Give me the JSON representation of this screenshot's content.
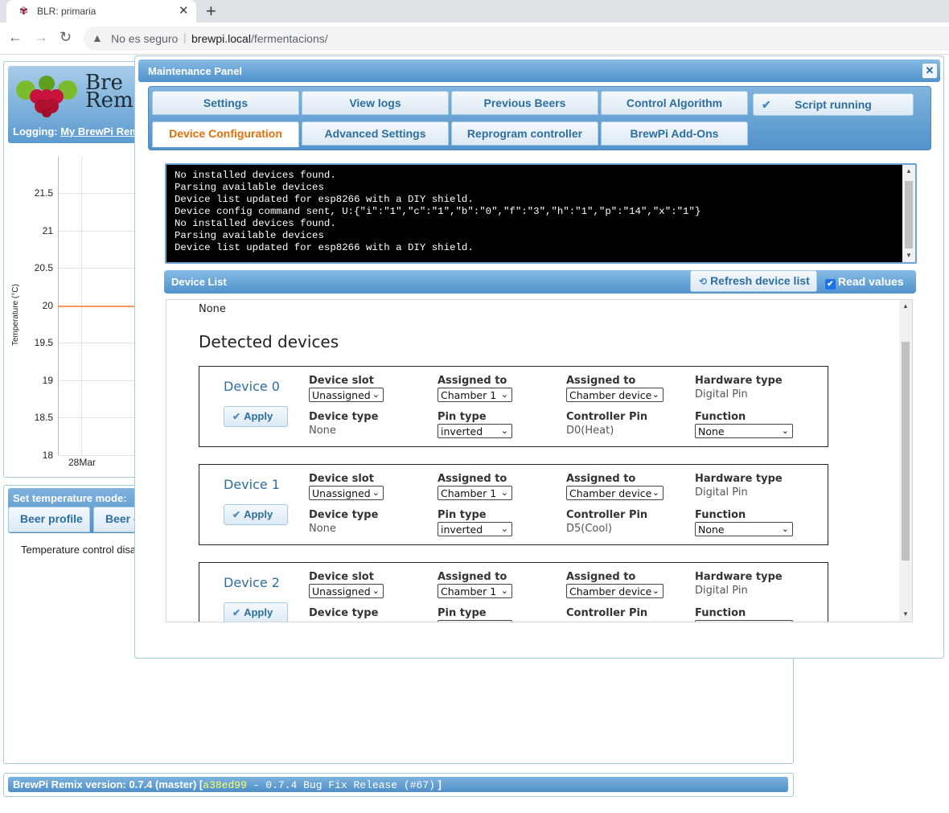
{
  "browser": {
    "tab_title": "BLR: primaria",
    "favicon": "raspberry-favicon",
    "insecure_text": "No es seguro",
    "url_host": "brewpi.local",
    "url_path": "/fermentacions/"
  },
  "background": {
    "logo_text_1": "Bre",
    "logo_text_2": "Rem",
    "logging_label": "Logging:",
    "logging_link": "My BrewPi Rem",
    "chart_ylabel": "Temperature (°C)",
    "y_ticks": [
      "21.5",
      "21",
      "20.5",
      "20",
      "19.5",
      "19",
      "18.5",
      "18"
    ],
    "x_tick": "28Mar",
    "set_temp_label": "Set temperature mode:",
    "mode_buttons": [
      "Beer profile",
      "Beer c"
    ],
    "temp_disabled": "Temperature control disa",
    "footer_version": "BrewPi Remix version: 0.7.4 (master) [",
    "footer_hash": "a38ed99",
    "footer_note": " - 0.7.4 Bug Fix Release (#67)",
    "footer_close": " ]"
  },
  "chart_data": {
    "type": "line",
    "ylabel": "Temperature (°C)",
    "ylim": [
      18,
      21.5
    ],
    "x": [
      "28Mar"
    ],
    "series": [
      {
        "values": [
          20
        ]
      }
    ]
  },
  "dialog": {
    "title": "Maintenance Panel",
    "close_icon": "close-icon",
    "tabs_row1": [
      "Settings",
      "View logs",
      "Previous Beers",
      "Control Algorithm",
      "Script running"
    ],
    "tabs_row2": [
      "Device Configuration",
      "Advanced Settings",
      "Reprogram controller",
      "BrewPi Add-Ons"
    ],
    "active_tab": "Device Configuration",
    "console_lines": [
      "No installed devices found.",
      "Parsing available devices",
      "Device list updated for esp8266 with a DIY shield.",
      "Device config command sent, U:{\"i\":\"1\",\"c\":\"1\",\"b\":\"0\",\"f\":\"3\",\"h\":\"1\",\"p\":\"14\",\"x\":\"1\"}",
      "No installed devices found.",
      "Parsing available devices",
      "Device list updated for esp8266 with a DIY shield."
    ],
    "device_list_title": "Device List",
    "refresh_label": "Refresh device list",
    "read_values_label": "Read values",
    "read_values_checked": true,
    "installed_none": "None",
    "detected_title": "Detected devices",
    "field_labels": {
      "device_slot": "Device slot",
      "assigned_to": "Assigned to",
      "hardware_type": "Hardware type",
      "device_type": "Device type",
      "pin_type": "Pin type",
      "controller_pin": "Controller Pin",
      "function": "Function"
    },
    "apply_label": "Apply",
    "devices": [
      {
        "name": "Device 0",
        "slot": "Unassigned",
        "chamber": "Chamber 1",
        "assigned_device": "Chamber device",
        "hardware_type": "Digital Pin",
        "device_type": "None",
        "pin_type": "inverted",
        "controller_pin": "D0(Heat)",
        "function": "None"
      },
      {
        "name": "Device 1",
        "slot": "Unassigned",
        "chamber": "Chamber 1",
        "assigned_device": "Chamber device",
        "hardware_type": "Digital Pin",
        "device_type": "None",
        "pin_type": "inverted",
        "controller_pin": "D5(Cool)",
        "function": "None"
      },
      {
        "name": "Device 2",
        "slot": "Unassigned",
        "chamber": "Chamber 1",
        "assigned_device": "Chamber device",
        "hardware_type": "Digital Pin",
        "device_type": "",
        "pin_type": "",
        "controller_pin": "",
        "function": ""
      }
    ]
  }
}
